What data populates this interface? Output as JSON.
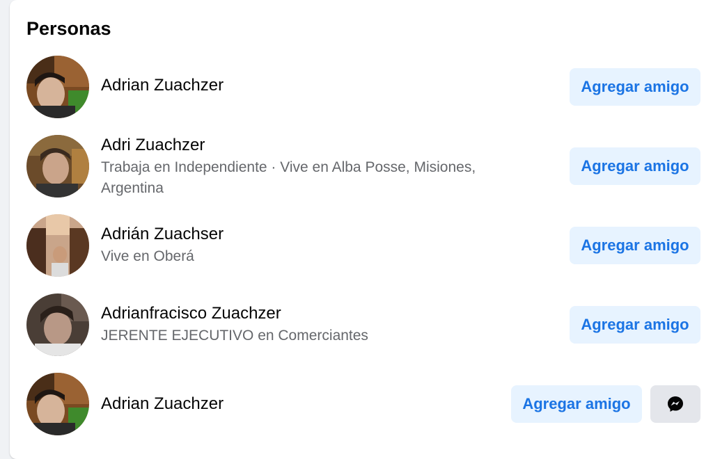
{
  "section": {
    "title": "Personas"
  },
  "people": [
    {
      "name": "Adrian Zuachzer",
      "detail": "",
      "button_label": "Agregar amigo"
    },
    {
      "name": "Adri Zuachzer",
      "detail": "Trabaja en Independiente · Vive en Alba Posse, Misiones, Argentina",
      "button_label": "Agregar amigo"
    },
    {
      "name": "Adrián Zuachser",
      "detail": "Vive en Oberá",
      "button_label": "Agregar amigo"
    },
    {
      "name": "Adrianfracisco Zuachzer",
      "detail": "JERENTE EJECUTIVO en Comerciantes",
      "button_label": "Agregar amigo"
    },
    {
      "name": "Adrian Zuachzer",
      "detail": "",
      "button_label": "Agregar amigo",
      "secondary_icon": "messenger-icon"
    }
  ],
  "colors": {
    "add_button_bg": "#e7f3ff",
    "add_button_text": "#1b74e4",
    "secondary_button_bg": "#e4e6eb",
    "name_text": "#050505",
    "detail_text": "#65676b"
  }
}
